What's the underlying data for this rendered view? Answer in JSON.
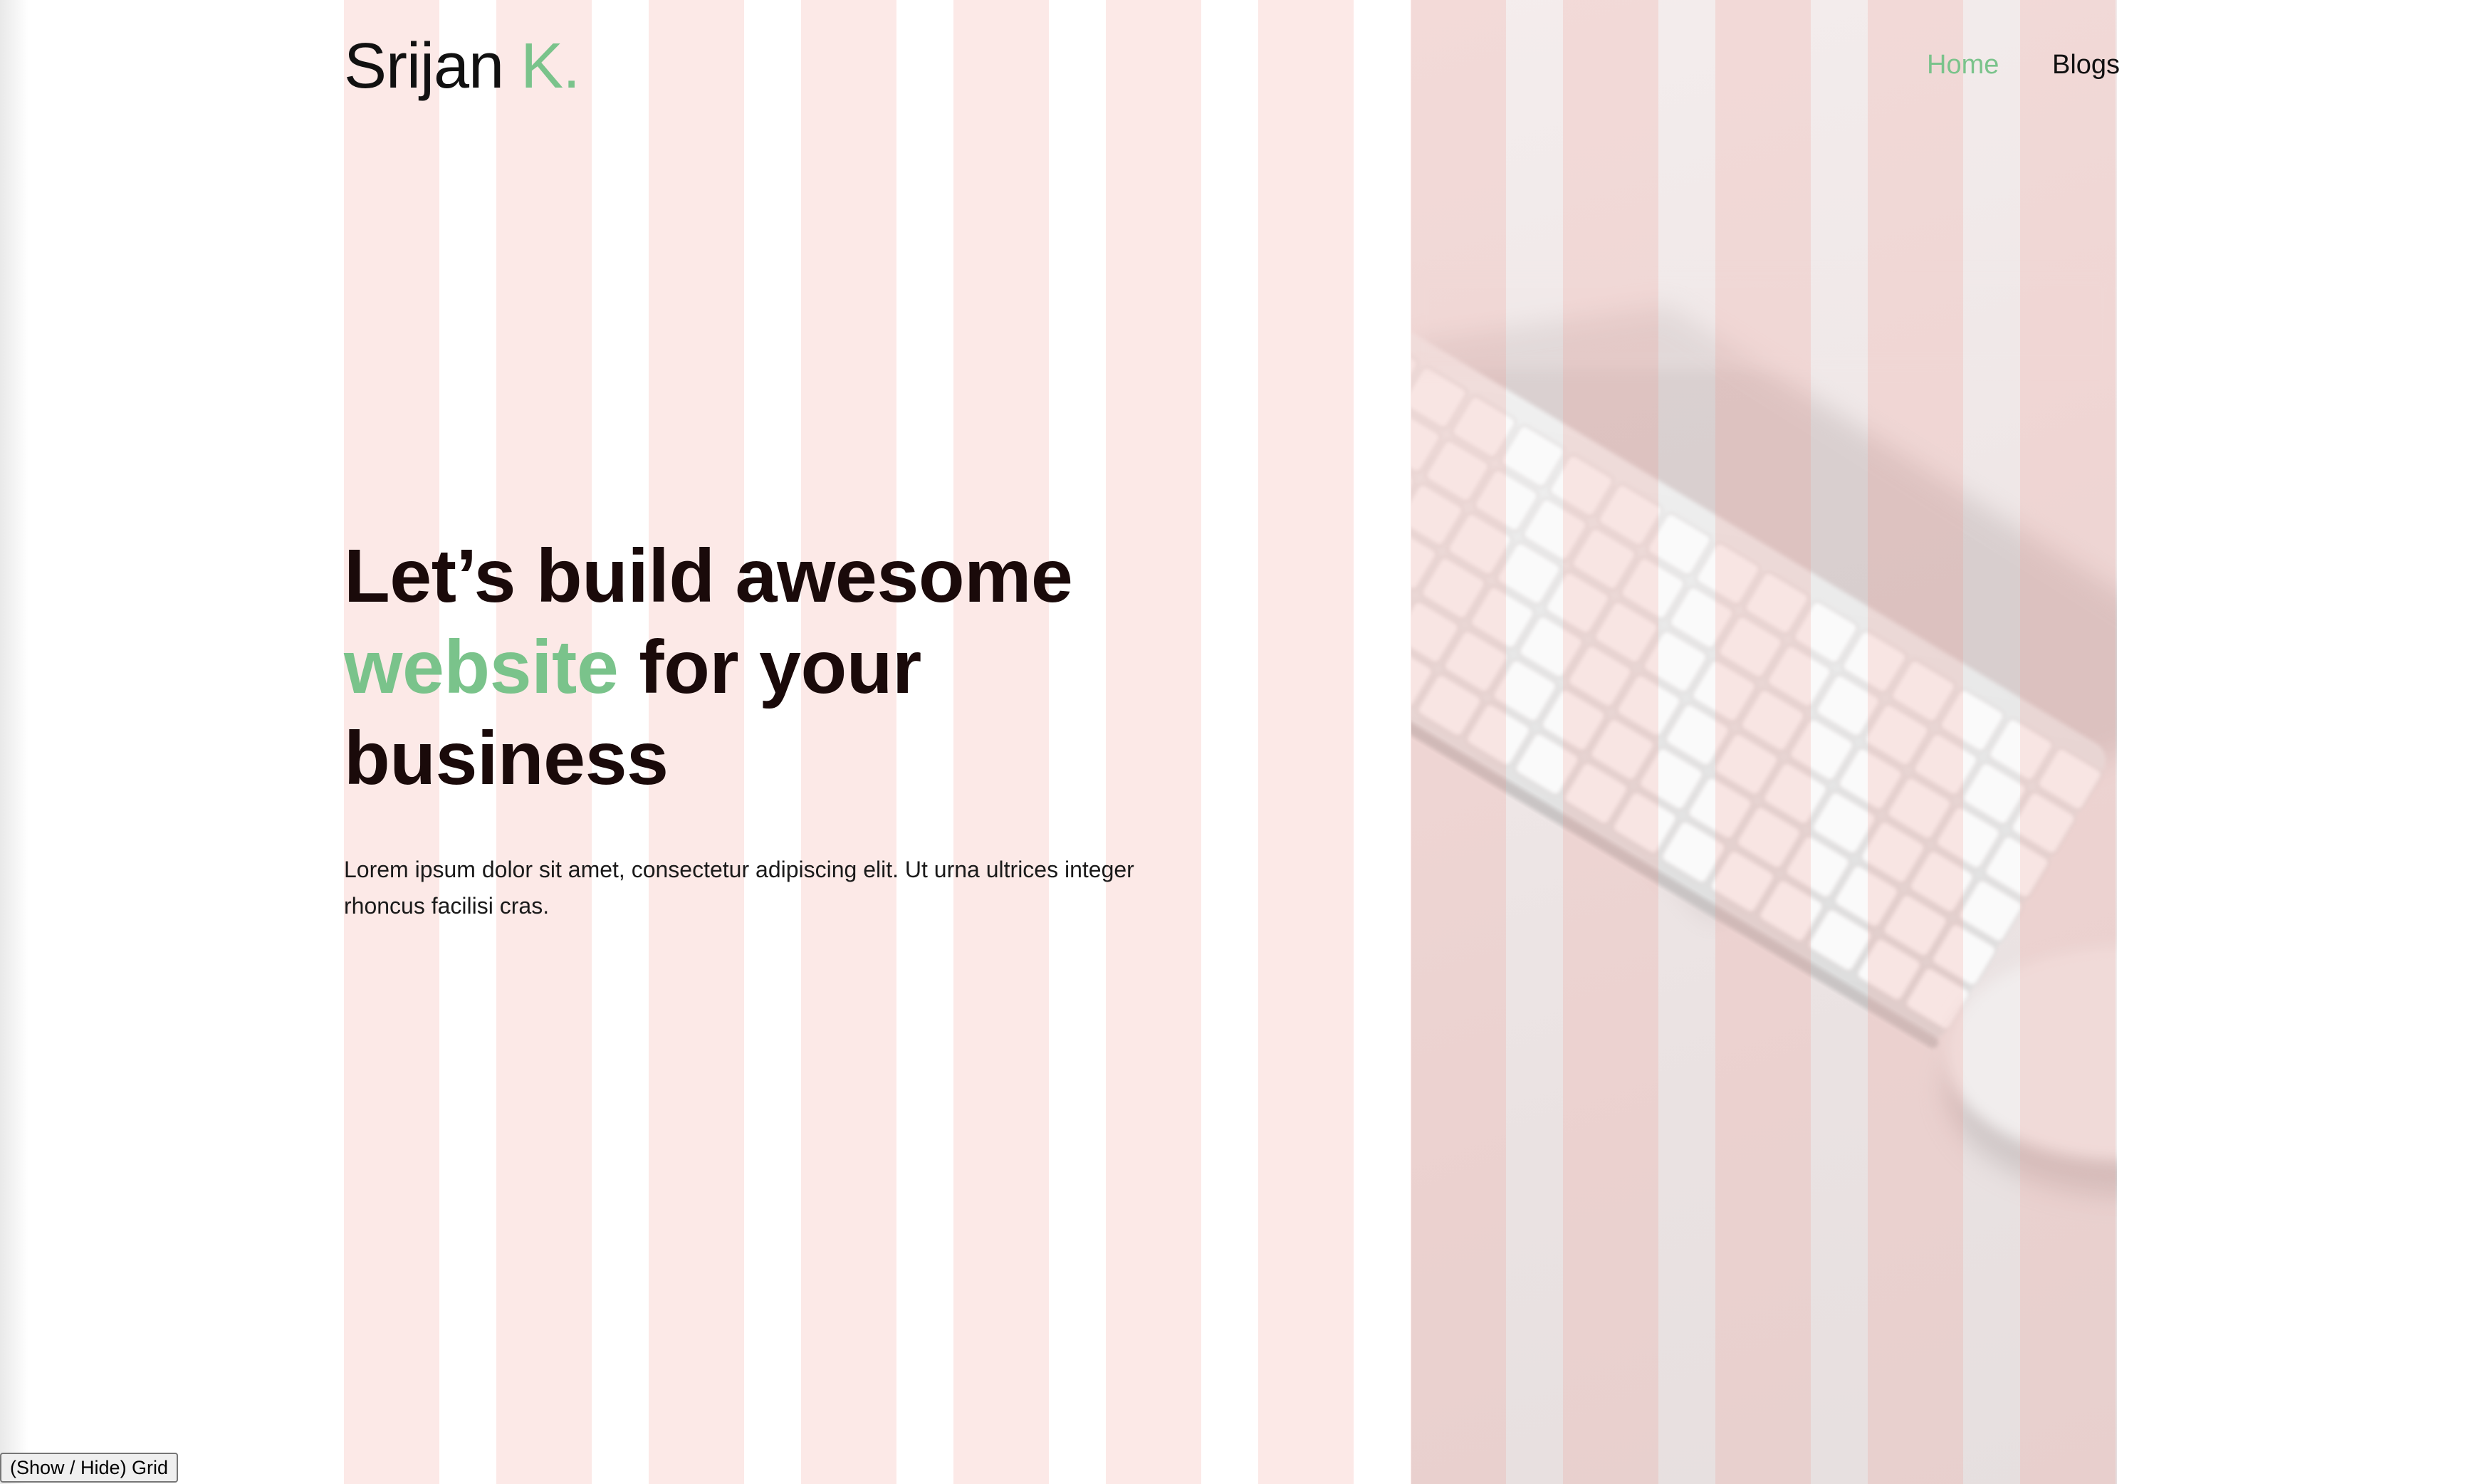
{
  "header": {
    "logo_name": "Srijan",
    "logo_accent": "K.",
    "nav": [
      {
        "label": "Home",
        "active": true
      },
      {
        "label": "Blogs",
        "active": false
      }
    ]
  },
  "hero": {
    "headline_line1": "Let’s build awesome",
    "headline_accent": "website",
    "headline_line2_rest": "for your",
    "headline_line3": "business",
    "paragraph": "Lorem ipsum dolor sit amet, consectetur adipiscing elit. Ut urna ultrices integer rhoncus facilisi cras.",
    "image_alt_icon": "keyboard-mouse-photo"
  },
  "controls": {
    "grid_toggle_label": "(Show / Hide) Grid"
  },
  "colors": {
    "accent": "#7ac38b",
    "text": "#1a0a0a",
    "grid_column": "#f19187"
  }
}
